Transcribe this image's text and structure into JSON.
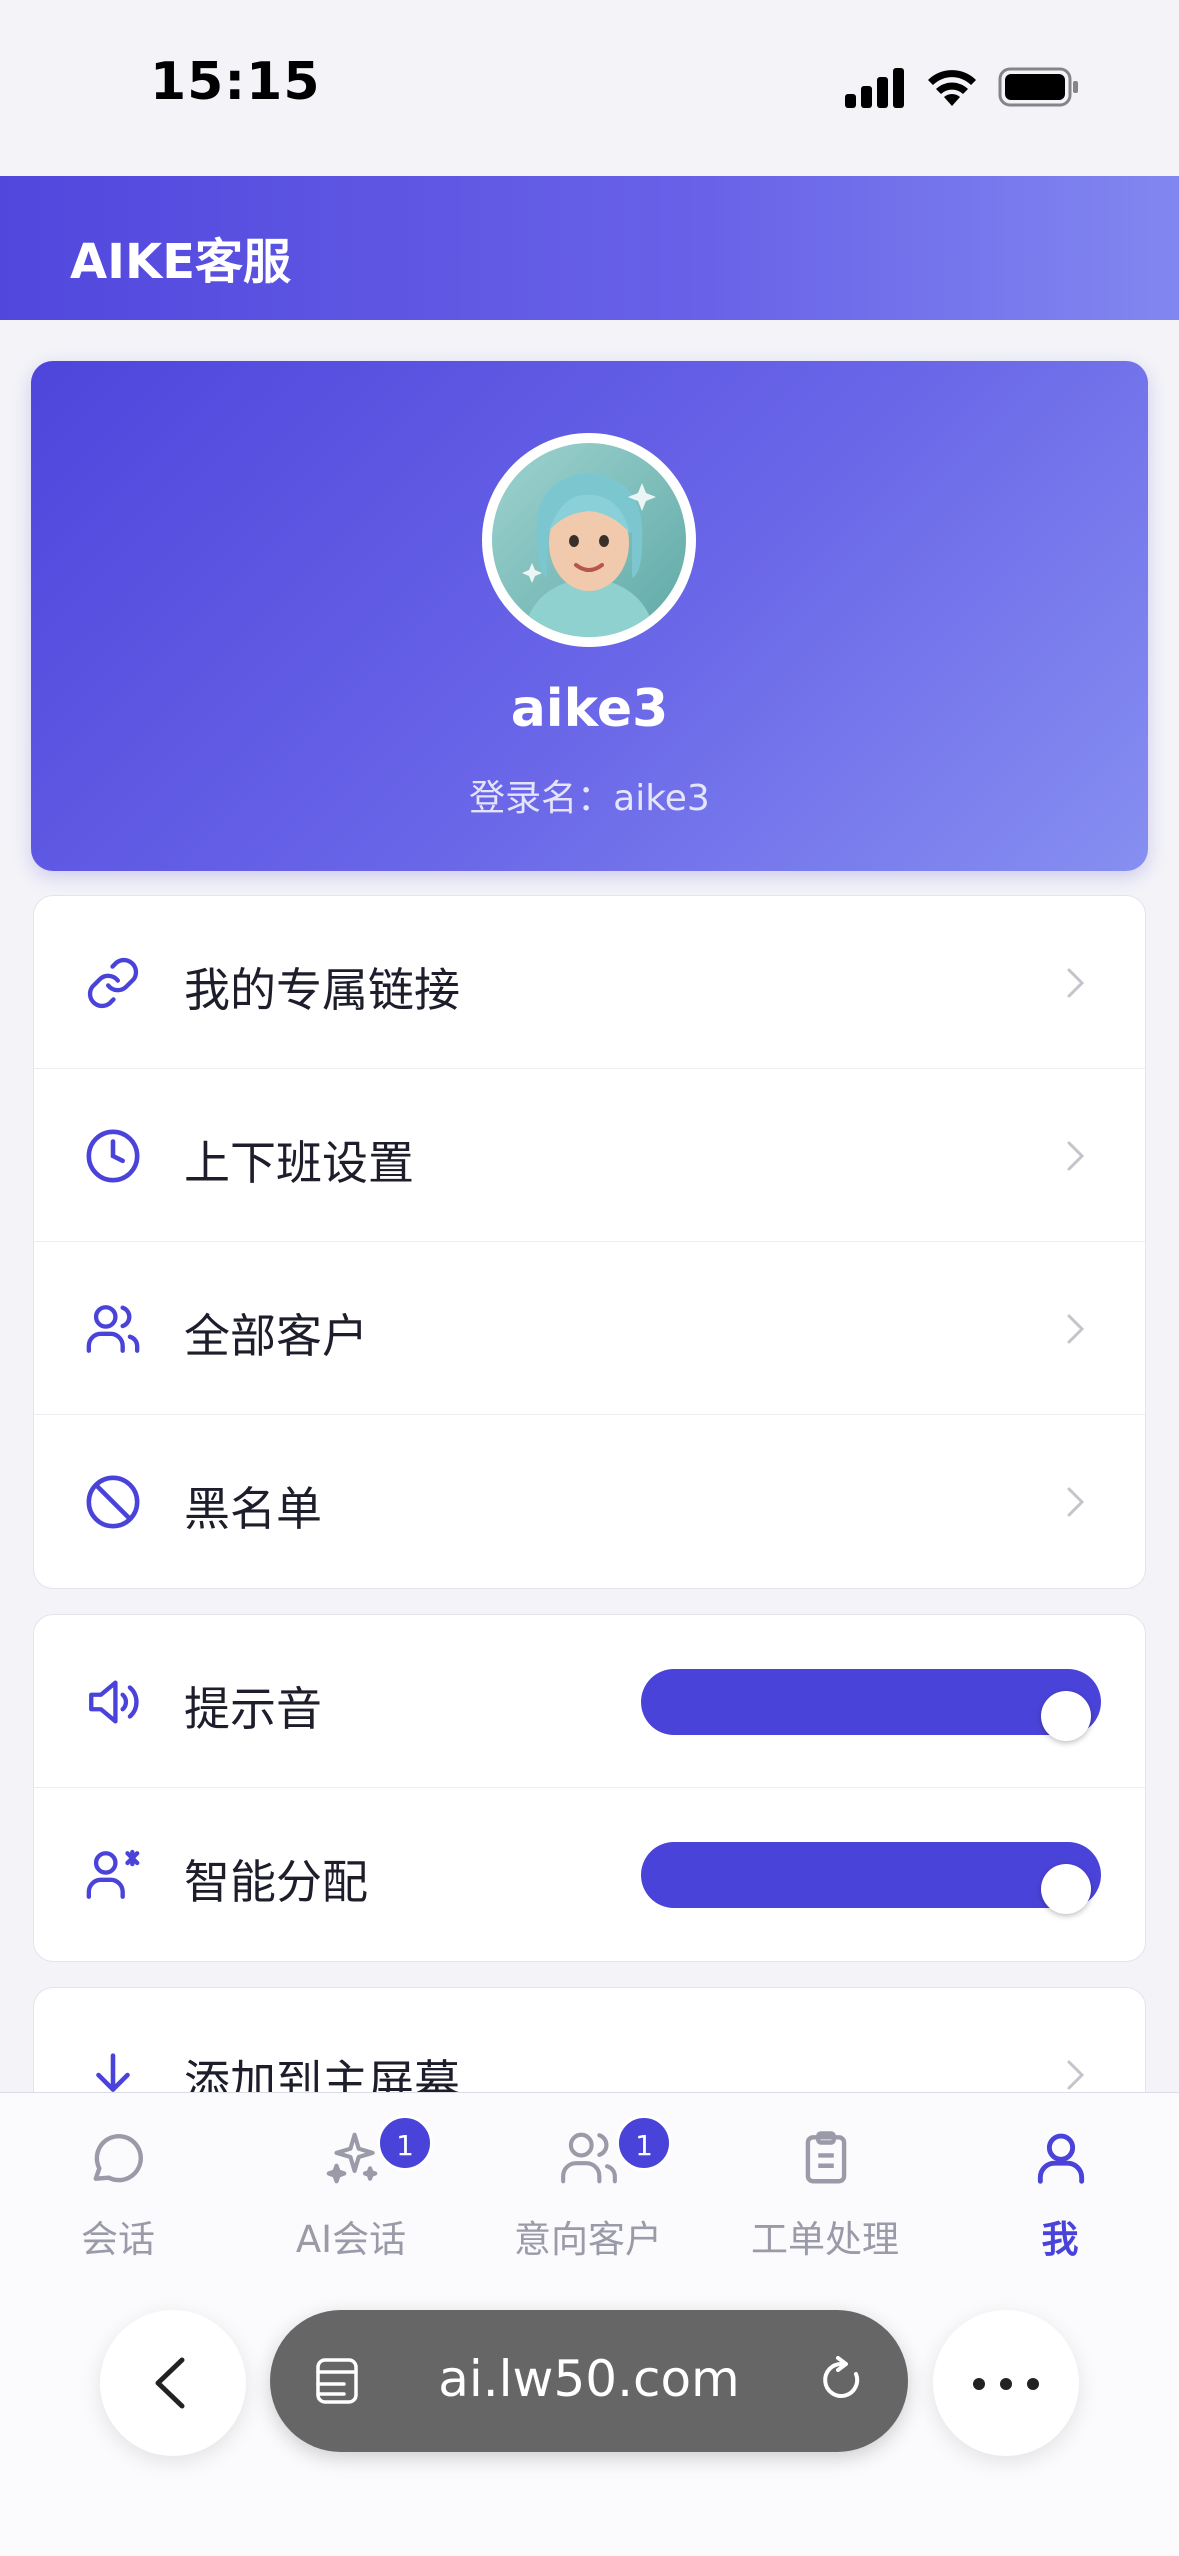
{
  "status_bar": {
    "time": "15:15"
  },
  "header": {
    "title": "AIKE客服"
  },
  "profile": {
    "name": "aike3",
    "login_line": "登录名：aike3"
  },
  "menu_group_1": {
    "items": [
      {
        "label": "我的专属链接",
        "icon": "link-icon"
      },
      {
        "label": "上下班设置",
        "icon": "clock-icon"
      },
      {
        "label": "全部客户",
        "icon": "users-icon"
      },
      {
        "label": "黑名单",
        "icon": "ban-icon"
      }
    ]
  },
  "menu_group_2": {
    "items": [
      {
        "label": "提示音",
        "icon": "speaker-icon",
        "toggle_on": true
      },
      {
        "label": "智能分配",
        "icon": "user-assign-icon",
        "toggle_on": true
      }
    ]
  },
  "menu_group_3": {
    "items": [
      {
        "label": "添加到主屏幕",
        "icon": "arrow-down-icon"
      }
    ]
  },
  "tabbar": {
    "tabs": [
      {
        "label": "会话",
        "icon": "chat-bubble-icon",
        "active": false
      },
      {
        "label": "AI会话",
        "icon": "sparkle-icon",
        "badge": "1",
        "active": false
      },
      {
        "label": "意向客户",
        "icon": "users-icon",
        "badge": "1",
        "active": false
      },
      {
        "label": "工单处理",
        "icon": "clipboard-icon",
        "active": false
      },
      {
        "label": "我",
        "icon": "person-icon",
        "active": true
      }
    ]
  },
  "browser": {
    "url": "ai.lw50.com"
  },
  "colors": {
    "accent": "#4a43d9",
    "header_gradient_start": "#5147dd",
    "header_gradient_end": "#8187f0"
  }
}
